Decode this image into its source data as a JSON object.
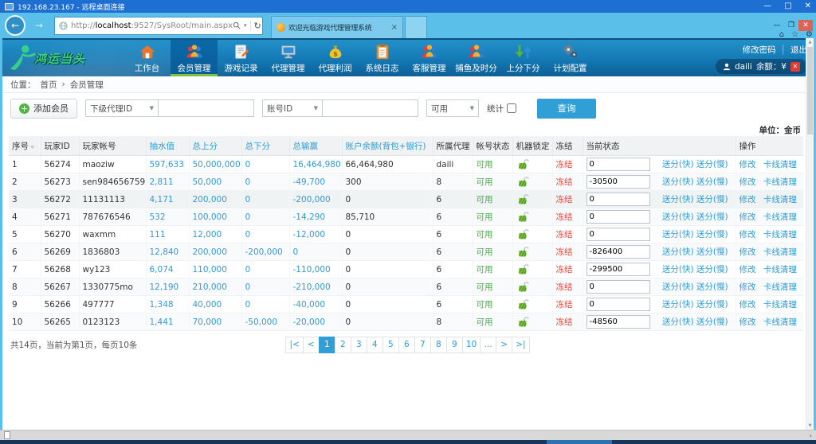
{
  "window": {
    "title": "192.168.23.167 - 远程桌面连接"
  },
  "browser": {
    "url": {
      "prefix": "http://",
      "host": "localhost",
      "path": ":9527/SysRoot/main.aspx"
    },
    "tab": {
      "title": "欢迎光临游戏代理管理系统",
      "close": "×"
    }
  },
  "header": {
    "logo": "鸿运当头",
    "nav": [
      {
        "label": "工作台",
        "icon": "home-icon",
        "active": false
      },
      {
        "label": "会员管理",
        "icon": "members-icon",
        "active": true
      },
      {
        "label": "游戏记录",
        "icon": "game-records-icon",
        "active": false
      },
      {
        "label": "代理管理",
        "icon": "agent-manage-icon",
        "active": false
      },
      {
        "label": "代理利润",
        "icon": "agent-profit-icon",
        "active": false
      },
      {
        "label": "系统日志",
        "icon": "system-log-icon",
        "active": false
      },
      {
        "label": "客服管理",
        "icon": "customer-service-icon",
        "active": false
      },
      {
        "label": "捕鱼及时分",
        "icon": "fishing-points-icon",
        "active": false
      },
      {
        "label": "上分下分",
        "icon": "updown-points-icon",
        "active": false
      },
      {
        "label": "计划配置",
        "icon": "plan-config-icon",
        "active": false
      }
    ],
    "links": {
      "change_password": "修改密码",
      "logout": "退出"
    },
    "user": {
      "name": "daili",
      "balance_label": "余额：¥",
      "badge": "✕"
    }
  },
  "breadcrumb": {
    "label": "位置：",
    "home": "首页",
    "separator": "›",
    "current": "会员管理"
  },
  "toolbar": {
    "add_member": "添加会员",
    "agent_select": "下级代理ID",
    "account_select": "账号ID",
    "status_select": "可用",
    "stat_label": "统计",
    "search": "查询"
  },
  "table": {
    "unit": "单位：金币",
    "headers": [
      "序号",
      "玩家ID",
      "玩家帐号",
      "抽水值",
      "总上分",
      "总下分",
      "总输赢",
      "账户余额(背包+银行)",
      "所属代理",
      "帐号状态",
      "机器锁定",
      "冻结",
      "当前状态",
      "操作"
    ],
    "links": {
      "send_fast": "送分(快)",
      "send_slow": "送分(慢)",
      "edit": "修改",
      "kick": "卡线清理"
    },
    "status_text": "可用",
    "freeze_text": "冻结",
    "rows": [
      {
        "seq": "1",
        "player_id": "56274",
        "account": "maoziw",
        "pump": "597,633",
        "up": "50,000,000",
        "down": "0",
        "winloss": "16,464,980",
        "balance": "66,464,980",
        "agent": "daili",
        "state": "0"
      },
      {
        "seq": "2",
        "player_id": "56273",
        "account": "sen984656759",
        "pump": "2,811",
        "up": "50,000",
        "down": "0",
        "winloss": "-49,700",
        "balance": "300",
        "agent": "8",
        "state": "-30500"
      },
      {
        "seq": "3",
        "player_id": "56272",
        "account": "11131113",
        "pump": "4,171",
        "up": "200,000",
        "down": "0",
        "winloss": "-200,000",
        "balance": "0",
        "agent": "6",
        "state": "0"
      },
      {
        "seq": "4",
        "player_id": "56271",
        "account": "787676546",
        "pump": "532",
        "up": "100,000",
        "down": "0",
        "winloss": "-14,290",
        "balance": "85,710",
        "agent": "6",
        "state": "0"
      },
      {
        "seq": "5",
        "player_id": "56270",
        "account": "waxmm",
        "pump": "111",
        "up": "12,000",
        "down": "0",
        "winloss": "-12,000",
        "balance": "0",
        "agent": "6",
        "state": "0"
      },
      {
        "seq": "6",
        "player_id": "56269",
        "account": "1836803",
        "pump": "12,840",
        "up": "200,000",
        "down": "-200,000",
        "winloss": "0",
        "balance": "0",
        "agent": "6",
        "state": "-826400"
      },
      {
        "seq": "7",
        "player_id": "56268",
        "account": "wy123",
        "pump": "6,074",
        "up": "110,000",
        "down": "0",
        "winloss": "-110,000",
        "balance": "0",
        "agent": "6",
        "state": "-299500"
      },
      {
        "seq": "8",
        "player_id": "56267",
        "account": "1330775mo",
        "pump": "12,190",
        "up": "210,000",
        "down": "0",
        "winloss": "-210,000",
        "balance": "0",
        "agent": "6",
        "state": "0"
      },
      {
        "seq": "9",
        "player_id": "56266",
        "account": "497777",
        "pump": "1,348",
        "up": "40,000",
        "down": "0",
        "winloss": "-40,000",
        "balance": "0",
        "agent": "6",
        "state": "0"
      },
      {
        "seq": "10",
        "player_id": "56265",
        "account": "0123123",
        "pump": "1,441",
        "up": "70,000",
        "down": "-50,000",
        "winloss": "-20,000",
        "balance": "0",
        "agent": "8",
        "state": "-48560"
      }
    ]
  },
  "pagination": {
    "summary": "共14页，当前为第1页，每页10条",
    "items": [
      "|<",
      "<",
      "1",
      "2",
      "3",
      "4",
      "5",
      "6",
      "7",
      "8",
      "9",
      "10",
      "...",
      ">",
      ">|"
    ],
    "active": "1"
  },
  "colors": {
    "accent": "#2f9fd6",
    "green": "#3fae49",
    "red": "#e8453c"
  }
}
